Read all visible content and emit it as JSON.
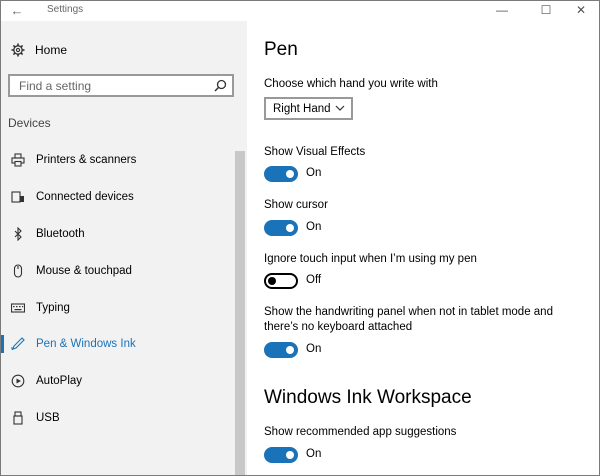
{
  "window": {
    "title": "Settings",
    "back_glyph": "←",
    "minimize_glyph": "—",
    "maximize_glyph": "☐",
    "close_glyph": "✕"
  },
  "sidebar": {
    "home_label": "Home",
    "search_placeholder": "Find a setting",
    "section_title": "Devices",
    "items": [
      {
        "label": "Printers & scanners",
        "icon": "printer-icon",
        "active": false
      },
      {
        "label": "Connected devices",
        "icon": "connected-devices-icon",
        "active": false
      },
      {
        "label": "Bluetooth",
        "icon": "bluetooth-icon",
        "active": false
      },
      {
        "label": "Mouse & touchpad",
        "icon": "mouse-icon",
        "active": false
      },
      {
        "label": "Typing",
        "icon": "keyboard-icon",
        "active": false
      },
      {
        "label": "Pen & Windows Ink",
        "icon": "pen-icon",
        "active": true
      },
      {
        "label": "AutoPlay",
        "icon": "autoplay-icon",
        "active": false
      },
      {
        "label": "USB",
        "icon": "usb-icon",
        "active": false
      }
    ]
  },
  "main": {
    "title": "Pen",
    "hand_label": "Choose which hand you write with",
    "hand_value": "Right Hand",
    "visual_effects": {
      "label": "Show Visual Effects",
      "state": "On"
    },
    "cursor": {
      "label": "Show cursor",
      "state": "On"
    },
    "ignore_touch": {
      "label": "Ignore touch input when I’m using my pen",
      "state": "Off"
    },
    "handwriting": {
      "label": "Show the handwriting panel when not in tablet mode and there’s no keyboard attached",
      "state": "On"
    },
    "ink_title": "Windows Ink Workspace",
    "app_suggestions": {
      "label": "Show recommended app suggestions",
      "state": "On"
    }
  },
  "colors": {
    "accent": "#1a73b8",
    "sidebar_bg": "#f2f2f2"
  }
}
